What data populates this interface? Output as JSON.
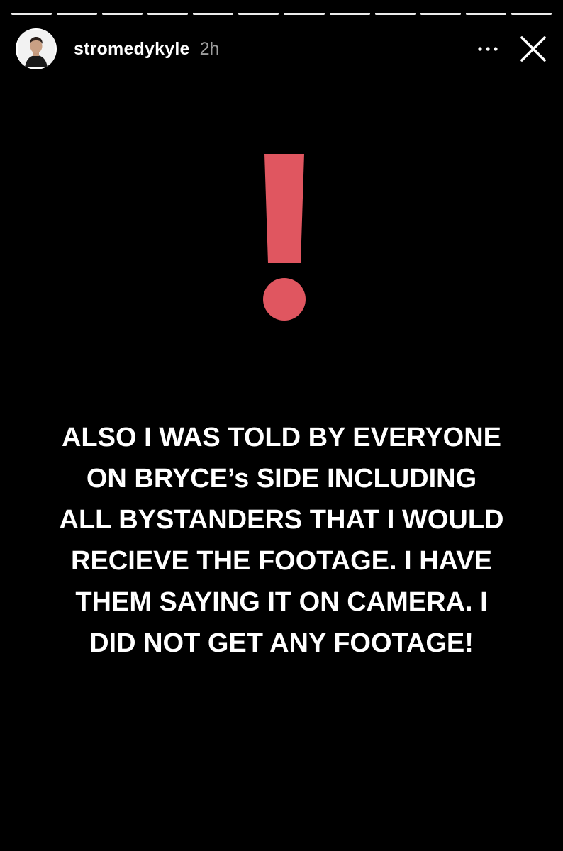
{
  "story": {
    "progress_segments": 12,
    "segments_seen": 12,
    "username": "stromedykyle",
    "timestamp": "2h",
    "more_icon": "more-horizontal-icon",
    "close_icon": "close-icon",
    "sticker": {
      "icon": "exclamation-icon",
      "color": "#e05660"
    },
    "text_lines": [
      "ALSO I WAS TOLD BY EVERYONE",
      "ON BRYCE’s SIDE INCLUDING",
      "ALL BYSTANDERS THAT I WOULD",
      "RECIEVE THE FOOTAGE. I HAVE",
      "THEM SAYING IT ON CAMERA. I",
      "DID NOT GET ANY FOOTAGE!"
    ]
  },
  "colors": {
    "background": "#000000",
    "text": "#ffffff",
    "accent": "#e05660"
  }
}
